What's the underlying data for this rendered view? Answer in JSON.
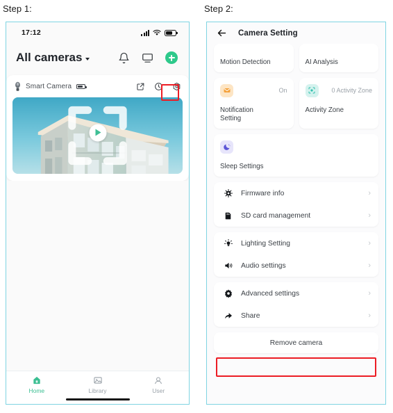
{
  "captions": {
    "step1": "Step 1:",
    "step2": "Step 2:"
  },
  "colors": {
    "panel_border": "#7fd4e2",
    "accent_green": "#2ec98b",
    "highlight_red": "#ec1c24",
    "icon_orange_bg": "#fde5c4",
    "icon_teal_bg": "#d5f2ee",
    "icon_purple_bg": "#e7e5fb"
  },
  "phone": {
    "statusbar": {
      "time": "17:12",
      "icons": [
        "signal-bars-icon",
        "wifi-icon",
        "battery-icon"
      ]
    },
    "header": {
      "title": "All cameras",
      "dropdown_icon": "chevron-down-icon",
      "actions": [
        "bell-icon",
        "monitor-icon",
        "add-device-icon"
      ]
    },
    "camera_card": {
      "icon": "camera-bulb-icon",
      "name": "Smart Camera",
      "battery_icon": "battery-icon",
      "actions": [
        "share-external-icon",
        "history-clock-icon",
        "settings-gear-icon"
      ],
      "video": {
        "play_icon": "play-icon",
        "fullscreen_icon": "fullscreen-icon"
      }
    },
    "tabbar": [
      {
        "label": "Home",
        "icon": "home-icon",
        "active": true
      },
      {
        "label": "Library",
        "icon": "library-image-icon",
        "active": false
      },
      {
        "label": "User",
        "icon": "user-icon",
        "active": false
      }
    ]
  },
  "settings": {
    "header": {
      "back_icon": "back-arrow-icon",
      "title": "Camera Setting"
    },
    "tiles_row1": [
      {
        "label": "Motion Detection"
      },
      {
        "label": "AI Analysis"
      }
    ],
    "tiles_row2": [
      {
        "label": "Notification\nSetting",
        "status": "On",
        "icon": "envelope-icon",
        "icon_style": "orange"
      },
      {
        "label": "Activity Zone",
        "status": "0 Activity Zone",
        "icon": "activity-zone-icon",
        "icon_style": "teal"
      }
    ],
    "tiles_row3": [
      {
        "label": "Sleep Settings",
        "status": "",
        "icon": "moon-icon",
        "icon_style": "purple"
      }
    ],
    "groups": [
      {
        "rows": [
          {
            "label": "Firmware info",
            "icon": "chip-icon",
            "chevron": "›",
            "highlighted": false
          },
          {
            "label": "SD card management",
            "icon": "sd-card-icon",
            "chevron": "›",
            "highlighted": false
          }
        ]
      },
      {
        "rows": [
          {
            "label": "Lighting Setting",
            "icon": "lightbulb-icon",
            "chevron": "›",
            "highlighted": false
          },
          {
            "label": "Audio settings",
            "icon": "speaker-icon",
            "chevron": "›",
            "highlighted": false
          }
        ]
      },
      {
        "rows": [
          {
            "label": "Advanced settings",
            "icon": "gear-icon",
            "chevron": "›",
            "highlighted": false
          },
          {
            "label": "Share",
            "icon": "share-arrow-icon",
            "chevron": "›",
            "highlighted": true
          }
        ]
      }
    ],
    "remove_button": {
      "label": "Remove camera"
    }
  }
}
